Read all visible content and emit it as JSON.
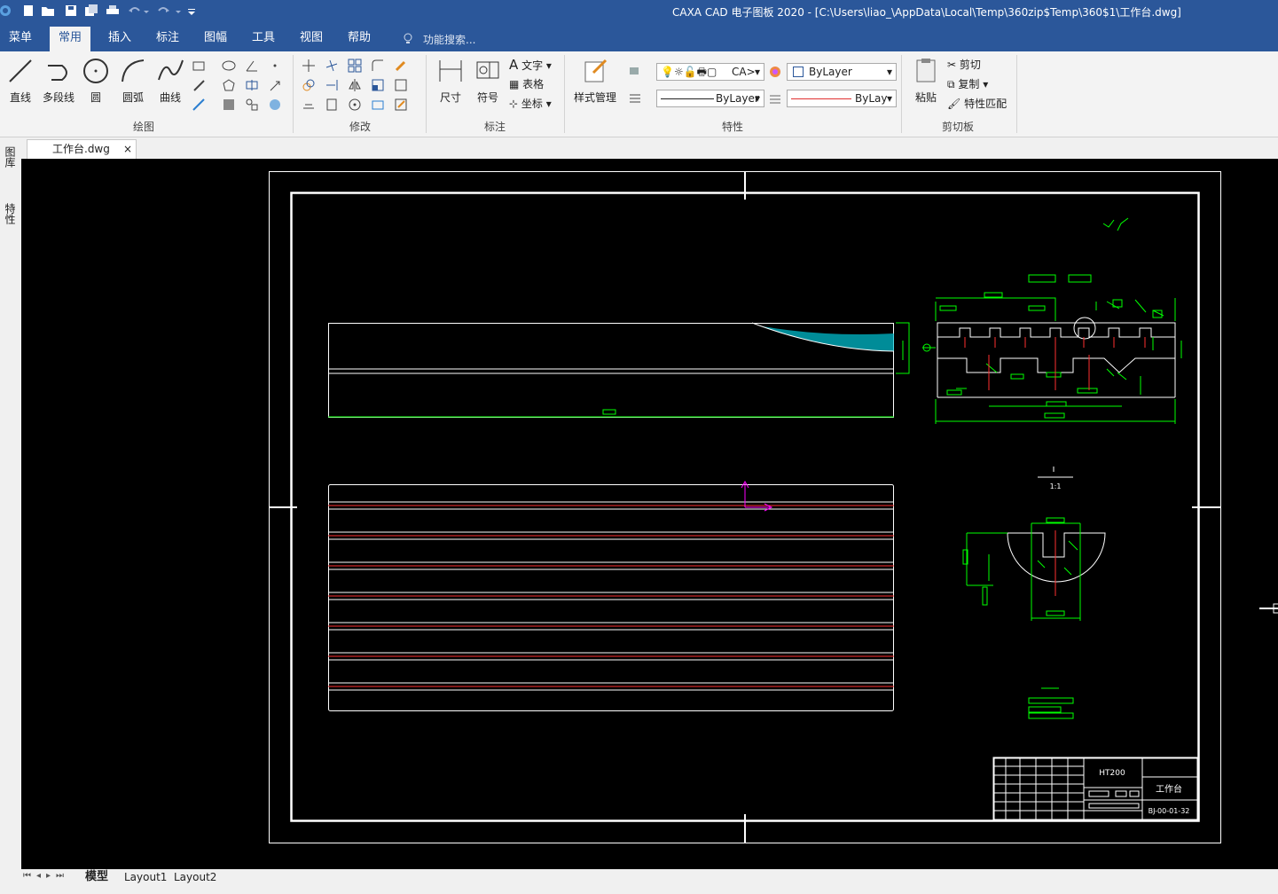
{
  "title_bar": {
    "title": "CAXA CAD 电子图板 2020 - [C:\\Users\\liao_\\AppData\\Local\\Temp\\360zip$Temp\\360$1\\工作台.dwg]"
  },
  "menu": {
    "items": [
      "菜单",
      "常用",
      "插入",
      "标注",
      "图幅",
      "工具",
      "视图",
      "帮助"
    ],
    "active": "常用",
    "search_placeholder": "功能搜索..."
  },
  "ribbon": {
    "draw": {
      "label": "绘图",
      "line": "直线",
      "polyline": "多段线",
      "circle": "圆",
      "arc": "圆弧",
      "curve": "曲线"
    },
    "modify": {
      "label": "修改"
    },
    "annotate": {
      "label": "标注",
      "dimension": "尺寸",
      "symbol": "符号",
      "text": "文字",
      "table": "表格",
      "coordinate": "坐标"
    },
    "properties": {
      "label": "特性",
      "style_manager": "样式管理",
      "layer_value": "CA>",
      "color_value": "ByLayer",
      "linetype_value": "ByLayer",
      "lineweight_value": "ByLay"
    },
    "clipboard": {
      "label": "剪切板",
      "paste": "粘贴",
      "cut": "剪切",
      "copy": "复制",
      "match": "特性匹配"
    }
  },
  "document_tab": {
    "name": "工作台.dwg",
    "close": "×"
  },
  "side_panels": [
    "图库",
    "特性"
  ],
  "drawing": {
    "material": "HT200",
    "part_name": "工作台",
    "drawing_no": "BJ-00-01-32",
    "scale": "1:1"
  },
  "layout_tabs": [
    "模型",
    "Layout1",
    "Layout2"
  ],
  "active_layout": "模型",
  "colors": {
    "title_bar": "#2b579a",
    "canvas": "#000000",
    "cad_white": "#ffffff",
    "cad_green": "#00ff00",
    "cad_red": "#ff3030",
    "cad_cyan": "#00c8d8",
    "cad_magenta": "#ff00ff"
  }
}
